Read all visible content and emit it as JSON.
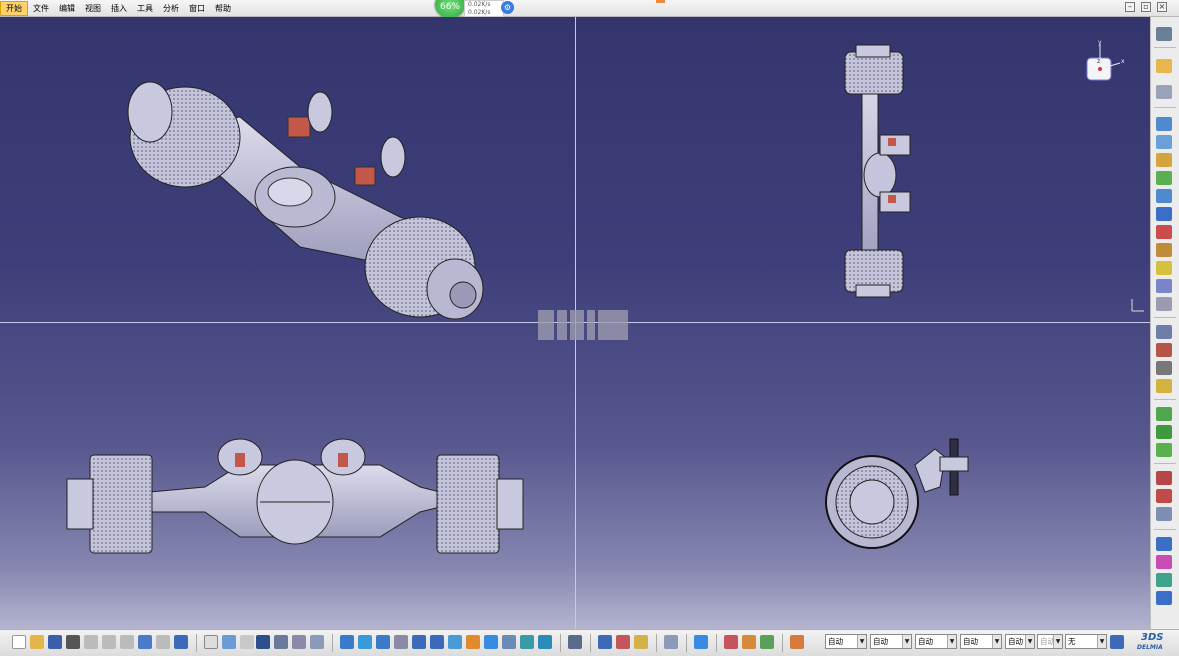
{
  "menu": {
    "items": [
      "开始",
      "文件",
      "编辑",
      "视图",
      "插入",
      "工具",
      "分析",
      "窗口",
      "帮助"
    ],
    "active_index": 0
  },
  "network_widget": {
    "percent": "66%",
    "upload": "0.02K/s",
    "download": "0.02K/s"
  },
  "compass": {
    "axis_x": "x",
    "axis_y": "y",
    "axis_z": "z"
  },
  "bottom_toolbar": {
    "dropdowns": [
      "自动",
      "自动",
      "自动",
      "自动",
      "自动",
      "自动",
      "无"
    ]
  },
  "brand": {
    "logo_letters": "3DS",
    "name": "DELMIA"
  },
  "colors": {
    "viewport_top": "#35356e",
    "viewport_bottom": "#b4b4cf",
    "part_fill": "#c5c5dc",
    "bracket_red": "#c2574a",
    "menu_active": "#ffd36b"
  }
}
